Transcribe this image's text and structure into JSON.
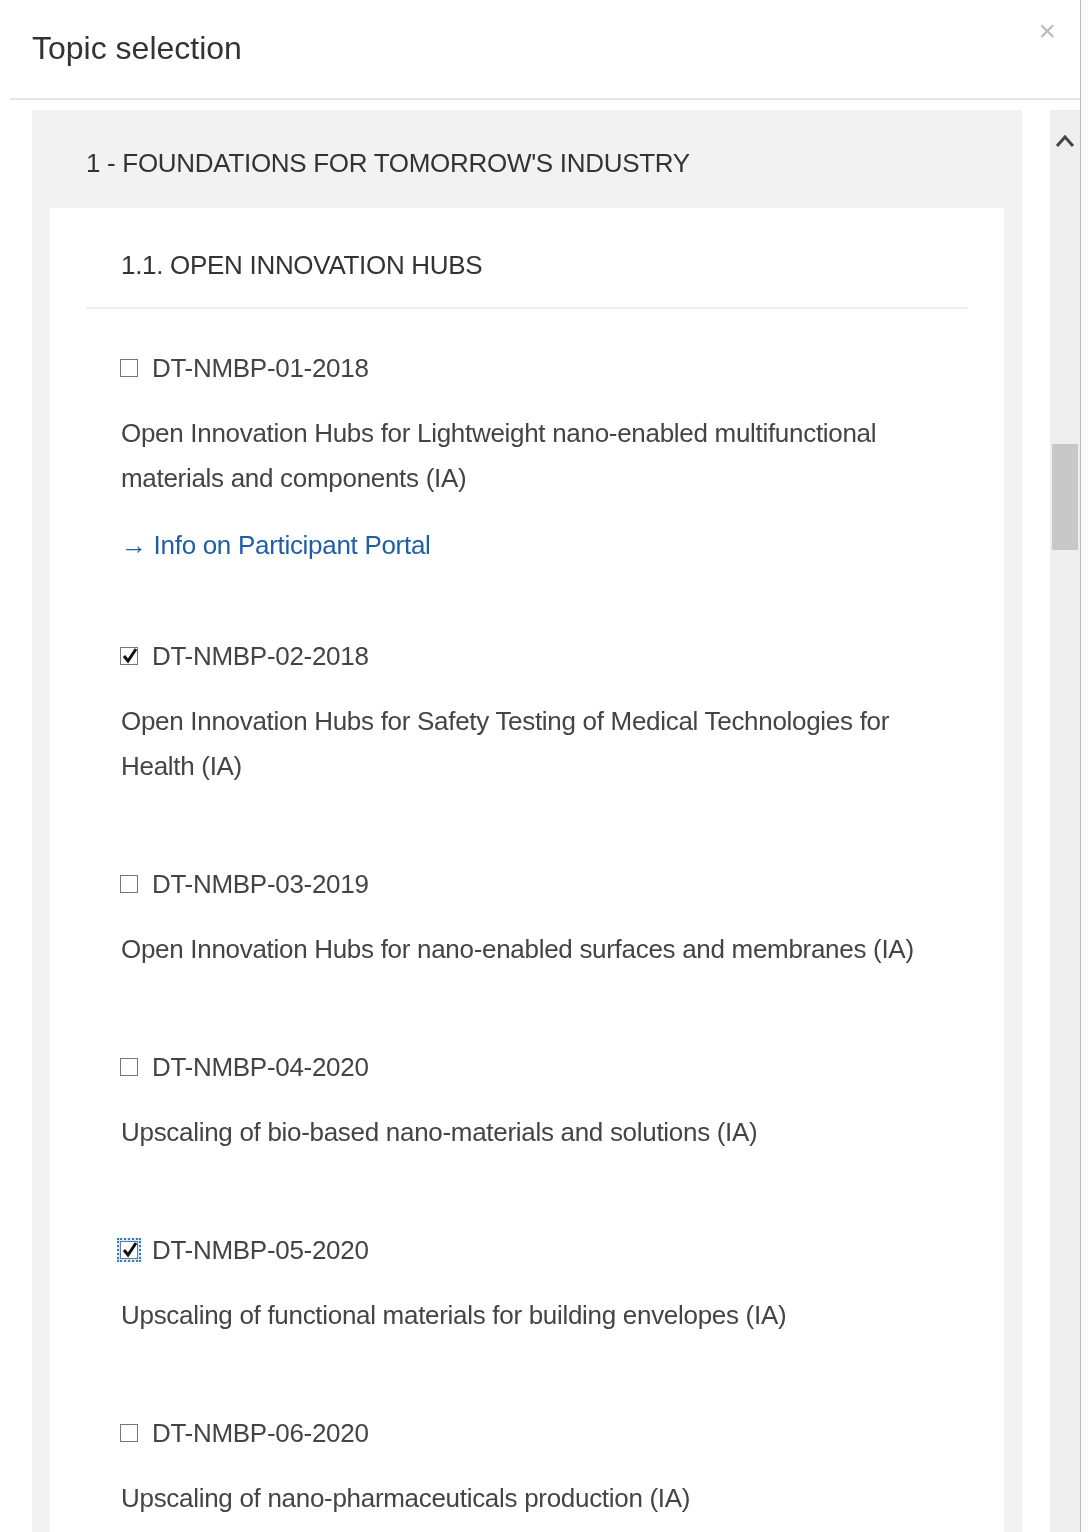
{
  "dialog": {
    "title": "Topic selection",
    "close": "×"
  },
  "section": {
    "title": "1 - FOUNDATIONS FOR TOMORROW'S INDUSTRY",
    "expanded": true,
    "group": {
      "title": "1.1. OPEN INNOVATION HUBS",
      "topics": [
        {
          "code": "DT-NMBP-01-2018",
          "description": "Open Innovation Hubs for Lightweight nano-enabled multifunctional materials and components (IA)",
          "checked": false,
          "focused": false,
          "link": "→ Info on Participant Portal"
        },
        {
          "code": "DT-NMBP-02-2018",
          "description": "Open Innovation Hubs for Safety Testing of Medical Technologies for Health (IA)",
          "checked": true,
          "focused": false
        },
        {
          "code": "DT-NMBP-03-2019",
          "description": "Open Innovation Hubs for nano-enabled surfaces and membranes (IA)",
          "checked": false,
          "focused": false
        },
        {
          "code": "DT-NMBP-04-2020",
          "description": "Upscaling of bio-based nano-materials and solutions (IA)",
          "checked": false,
          "focused": false
        },
        {
          "code": "DT-NMBP-05-2020",
          "description": "Upscaling of functional materials for building envelopes (IA)",
          "checked": true,
          "focused": true
        },
        {
          "code": "DT-NMBP-06-2020",
          "description": "Upscaling of nano-pharmaceuticals production (IA)",
          "checked": false,
          "focused": false
        }
      ]
    }
  }
}
